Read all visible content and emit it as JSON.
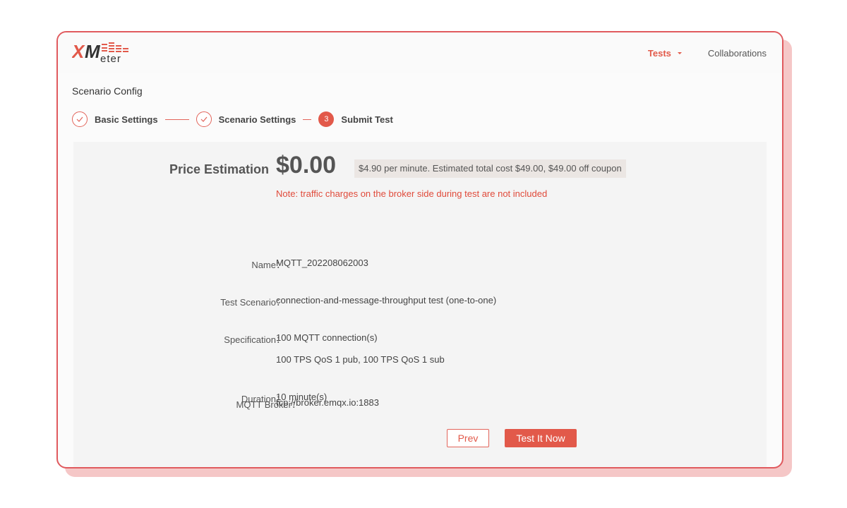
{
  "brand": {
    "logo_text": "XMeter",
    "accent_color": "#e2594a"
  },
  "nav": {
    "tests_label": "Tests",
    "collaborations_label": "Collaborations"
  },
  "page": {
    "title": "Scenario Config"
  },
  "steps": [
    {
      "label": "Basic Settings",
      "status": "done"
    },
    {
      "label": "Scenario Settings",
      "status": "done"
    },
    {
      "label": "Submit Test",
      "status": "active",
      "number": "3"
    }
  ],
  "price": {
    "label": "Price Estimation",
    "value": "$0.00",
    "detail": "$4.90 per minute. Estimated total cost $49.00, $49.00 off coupon",
    "note": "Note: traffic charges on the broker side during test are not included"
  },
  "summary": {
    "name_label": "Name：",
    "name_value": "MQTT_202208062003",
    "scenario_label": "Test Scenario：",
    "scenario_value": "connection-and-message-throughput test (one-to-one)",
    "spec_label": "Specification：",
    "spec_value_1": "100 MQTT connection(s)",
    "spec_value_2": "100 TPS QoS 1 pub, 100 TPS QoS 1 sub",
    "duration_label": "Duration：",
    "duration_value": "10 minute(s)",
    "broker_label": "MQTT Broker：",
    "broker_value": "tcp://broker.emqx.io:1883"
  },
  "actions": {
    "prev_label": "Prev",
    "test_now_label": "Test It Now"
  }
}
